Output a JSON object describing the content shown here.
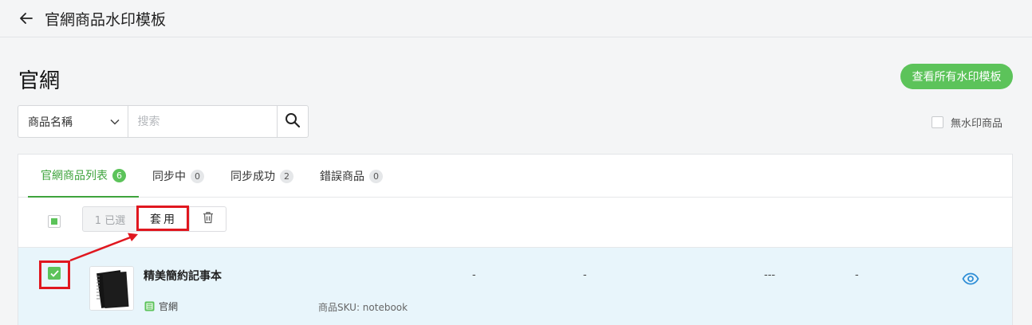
{
  "header": {
    "title": "官網商品水印模板"
  },
  "page": {
    "title": "官網",
    "view_all_label": "查看所有水印模板"
  },
  "search": {
    "field_selected": "商品名稱",
    "placeholder": "搜索"
  },
  "filter": {
    "no_watermark_label": "無水印商品",
    "checked": false
  },
  "tabs": [
    {
      "label": "官網商品列表",
      "count": "6",
      "active": true
    },
    {
      "label": "同步中",
      "count": "0",
      "active": false
    },
    {
      "label": "同步成功",
      "count": "2",
      "active": false
    },
    {
      "label": "錯誤商品",
      "count": "0",
      "active": false
    }
  ],
  "bulk": {
    "selected_label": "1 已選",
    "apply_label": "套用",
    "select_all_state": "partial"
  },
  "products": [
    {
      "name": "精美簡約記事本",
      "channel": "官網",
      "sku": "商品SKU: notebook",
      "cols": [
        "-",
        "-",
        "---",
        "-"
      ],
      "checked": true
    }
  ],
  "colors": {
    "accent": "#5cc35a",
    "annotation": "#e0171f",
    "row_highlight": "#e8f5fb",
    "eye": "#2f8ed6"
  }
}
